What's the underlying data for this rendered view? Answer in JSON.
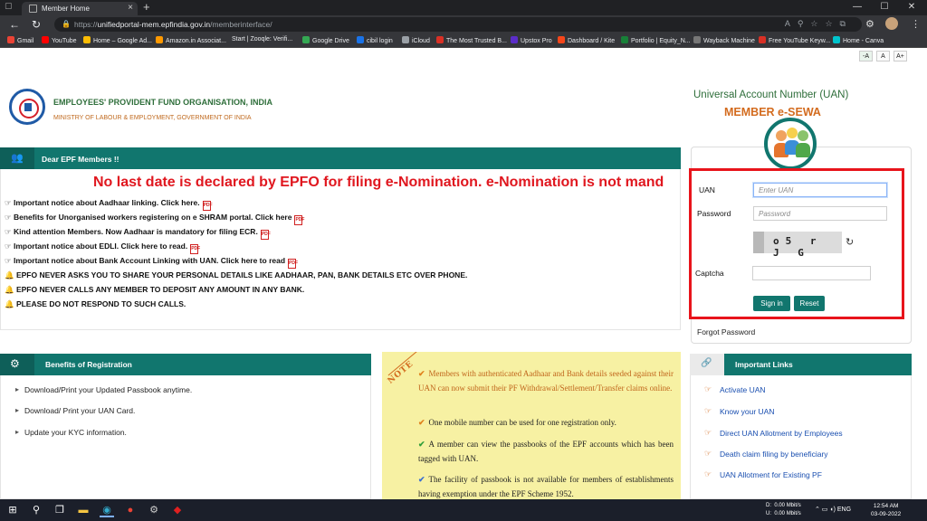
{
  "browser": {
    "tab_title": "Member Home",
    "tab_new": "+",
    "url_prefix": "https://",
    "url_host": "unifiedportal-mem.epfindia.gov.in",
    "url_path": "/memberinterface/",
    "window_min": "—",
    "window_max": "☐",
    "window_close": "✕",
    "bookmarks": [
      {
        "label": "Gmail",
        "color": "#ea4335"
      },
      {
        "label": "YouTube",
        "color": "#ff0000"
      },
      {
        "label": "Home – Google Ad...",
        "color": "#fbbc04"
      },
      {
        "label": "Amazon.in Associat...",
        "color": "#ff9900"
      },
      {
        "label": "Start | Zooqle: Verifi...",
        "color": "#333333"
      },
      {
        "label": "Google Drive",
        "color": "#34a853"
      },
      {
        "label": "cibil login",
        "color": "#1a73e8"
      },
      {
        "label": "iCloud",
        "color": "#9aa0a6"
      },
      {
        "label": "The Most Trusted B...",
        "color": "#d93025"
      },
      {
        "label": "Upstox Pro",
        "color": "#5b2dc9"
      },
      {
        "label": "Dashboard / Kite",
        "color": "#f6461a"
      },
      {
        "label": "Portfolio | Equity_N...",
        "color": "#188038"
      },
      {
        "label": "Wayback Machine",
        "color": "#777777"
      },
      {
        "label": "Free YouTube Keyw...",
        "color": "#d93025"
      },
      {
        "label": "Home - Canva",
        "color": "#00c4cc"
      }
    ]
  },
  "font_size": {
    "small": "-A",
    "normal": "A",
    "large": "A+"
  },
  "header": {
    "org_name": "EMPLOYEES' PROVIDENT FUND ORGANISATION, INDIA",
    "org_sub": "MINISTRY OF LABOUR & EMPLOYMENT, GOVERNMENT OF INDIA",
    "uan_title": "Universal Account Number (UAN)",
    "sewa_title": "MEMBER e-SEWA"
  },
  "notices": {
    "title": "Dear EPF Members !!",
    "marquee": "No last date is declared by EPFO for filing e-Nomination. e-Nomination is not mand",
    "items": [
      {
        "text": "☞ Important notice about Aadhaar linking. Click here.",
        "pdf": true
      },
      {
        "text": "☞ Benefits for Unorganised workers registering on e SHRAM portal. Click here",
        "pdf": true
      },
      {
        "text": "☞ Kind attention Members. Now Aadhaar is mandatory for filing ECR.",
        "pdf": true
      },
      {
        "text": "☞ Important notice about EDLI. Click here to read.",
        "pdf": true
      },
      {
        "text": "☞ Important notice about Bank Account Linking with UAN. Click here to read",
        "pdf": true
      },
      {
        "text": "🔔 EPFO NEVER ASKS YOU TO SHARE YOUR PERSONAL DETAILS LIKE AADHAAR, PAN, BANK DETAILS ETC OVER PHONE.",
        "pdf": false
      },
      {
        "text": "🔔 EPFO NEVER CALLS ANY MEMBER TO DEPOSIT ANY AMOUNT IN ANY BANK.",
        "pdf": false
      },
      {
        "text": "🔔 PLEASE DO NOT RESPOND TO SUCH CALLS.",
        "pdf": false
      }
    ],
    "pdf_label": "PDF"
  },
  "login": {
    "uan_label": "UAN",
    "uan_placeholder": "Enter UAN",
    "password_label": "Password",
    "password_placeholder": "Password",
    "captcha_text": "o5 r J G",
    "captcha_label": "Captcha",
    "sign_in": "Sign in",
    "reset": "Reset",
    "forgot": "Forgot Password"
  },
  "benefits": {
    "title": "Benefits of Registration",
    "items": [
      "Download/Print your Updated Passbook anytime.",
      "Download/ Print your UAN Card.",
      "Update your KYC information."
    ]
  },
  "note": {
    "tag": "NOTE",
    "items": [
      {
        "tick_color": "#e0821e",
        "text": "Members with authenticated Aadhaar and Bank details seeded against their UAN can now submit their PF Withdrawal/Settlement/Transfer claims online.",
        "text_color": "#c0651b"
      },
      {
        "tick_color": "#e0821e",
        "text": "One mobile number can be used for one registration only.",
        "text_color": "#222222"
      },
      {
        "tick_color": "#2e9e3a",
        "text": "A member can view the passbooks of the EPF accounts which has been tagged with UAN.",
        "text_color": "#222222"
      },
      {
        "tick_color": "#3a6fd0",
        "text": "The facility of passbook is not available for members of establishments having exemption under the EPF Scheme 1952.",
        "text_color": "#222222"
      }
    ]
  },
  "important_links": {
    "title": "Important Links",
    "items": [
      "Activate UAN",
      "Know your UAN",
      "Direct UAN Allotment by Employees",
      "Death claim filing by beneficiary",
      "UAN Allotment for Existing PF"
    ]
  },
  "taskbar": {
    "net_d_label": "D:",
    "net_d": "0.00 Mbit/s",
    "net_u_label": "U:",
    "net_u": "0.00 Mbit/s",
    "lang": "ENG",
    "time": "12:54 AM",
    "date": "03-09-2022"
  },
  "colors": {
    "primary_teal": "#11766e",
    "alert_red": "#e0171f",
    "accent_orange": "#d36b1e"
  }
}
